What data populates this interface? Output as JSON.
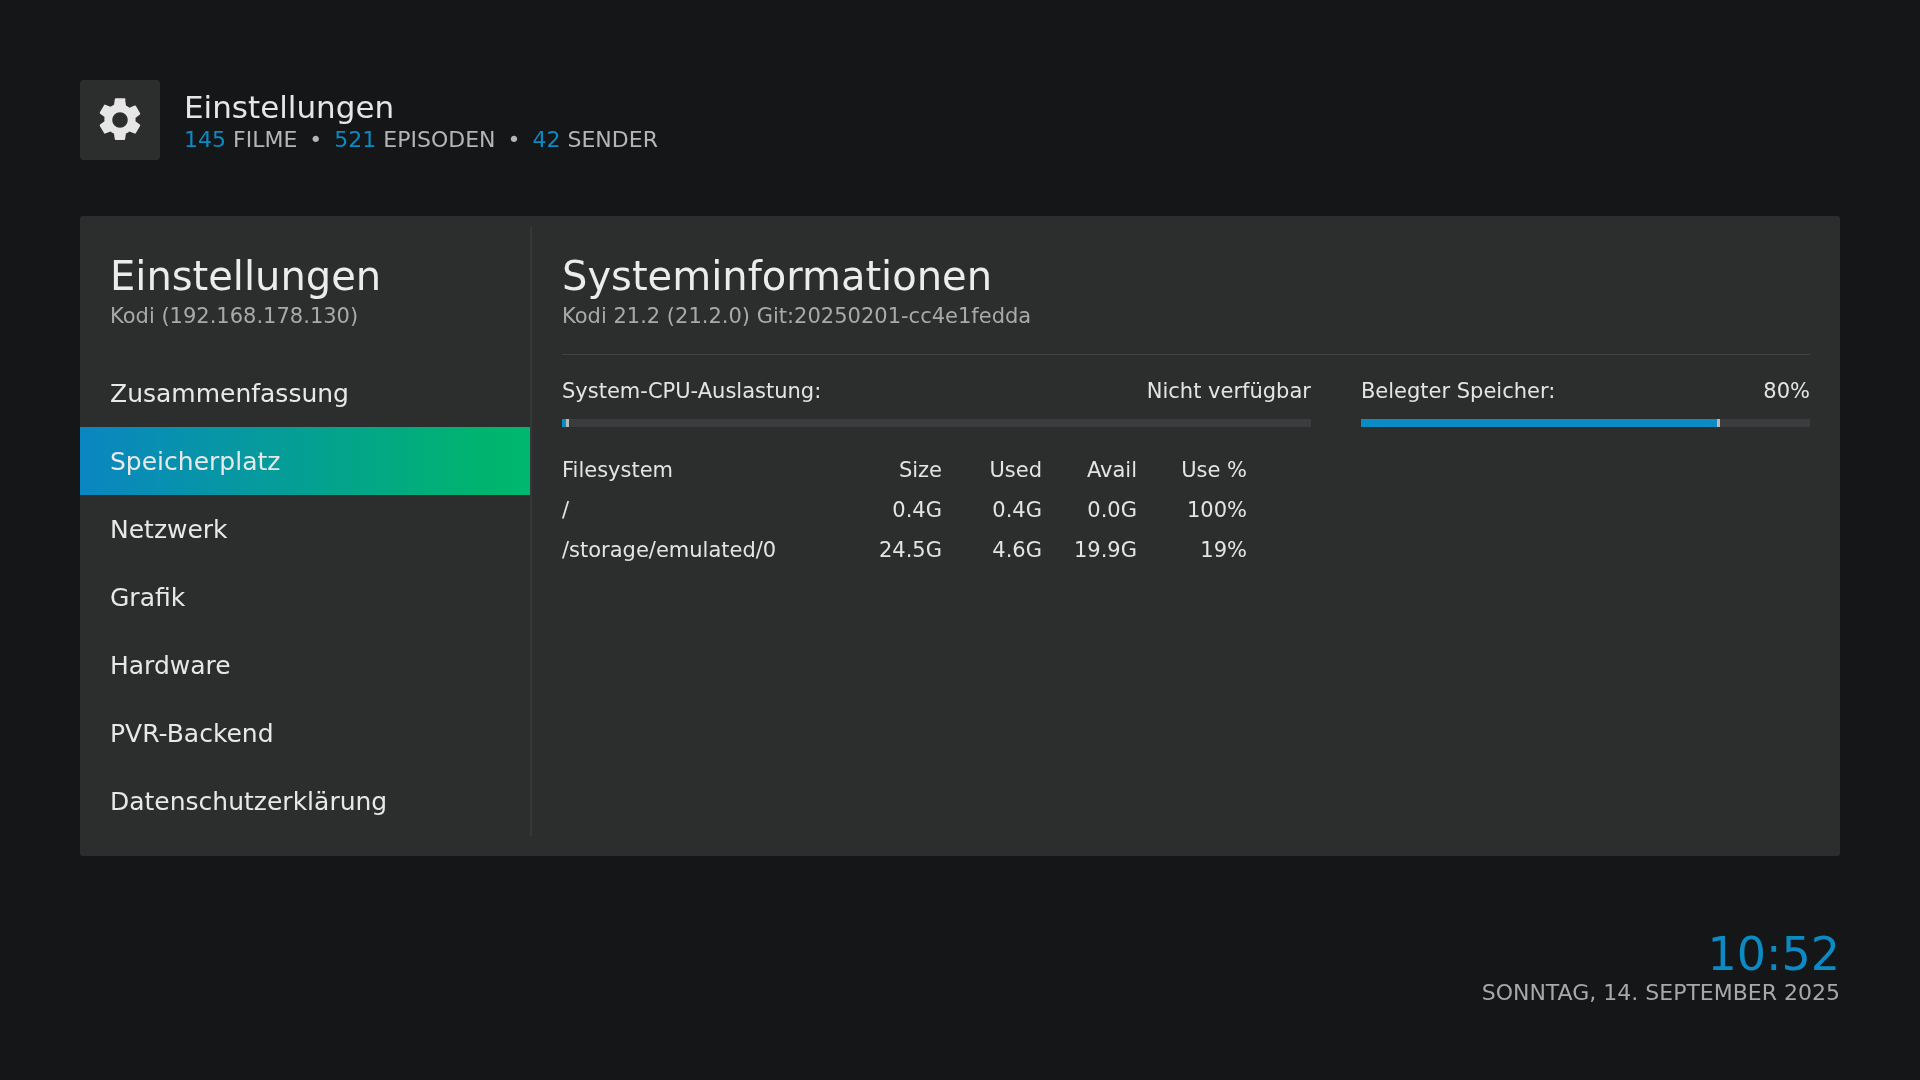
{
  "header": {
    "title": "Einstellungen",
    "stats": [
      {
        "count": "145",
        "label": "FILME"
      },
      {
        "count": "521",
        "label": "EPISODEN"
      },
      {
        "count": "42",
        "label": "SENDER"
      }
    ],
    "separator": "•"
  },
  "sidebar": {
    "title": "Einstellungen",
    "subtitle": "Kodi (192.168.178.130)",
    "items": [
      {
        "label": "Zusammenfassung",
        "selected": false
      },
      {
        "label": "Speicherplatz",
        "selected": true
      },
      {
        "label": "Netzwerk",
        "selected": false
      },
      {
        "label": "Grafik",
        "selected": false
      },
      {
        "label": "Hardware",
        "selected": false
      },
      {
        "label": "PVR-Backend",
        "selected": false
      },
      {
        "label": "Datenschutzerklärung",
        "selected": false
      }
    ]
  },
  "content": {
    "title": "Systeminformationen",
    "subtitle": "Kodi 21.2 (21.2.0) Git:20250201-cc4e1fedda",
    "meters": [
      {
        "label": "System-CPU-Auslastung:",
        "reading": "Nicht verfügbar",
        "level": 0.01
      },
      {
        "label": "Belegter Speicher:",
        "reading": "80%",
        "level": 0.8
      }
    ],
    "table": {
      "columns": [
        "Filesystem",
        "Size",
        "Used",
        "Avail",
        "Use %"
      ],
      "rows": [
        [
          "/",
          "0.4G",
          "0.4G",
          "0.0G",
          "100%"
        ],
        [
          "/storage/emulated/0",
          "24.5G",
          "4.6G",
          "19.9G",
          "19%"
        ]
      ]
    }
  },
  "clock": {
    "time": "10:52",
    "date": "SONNTAG, 14. SEPTEMBER 2025"
  }
}
